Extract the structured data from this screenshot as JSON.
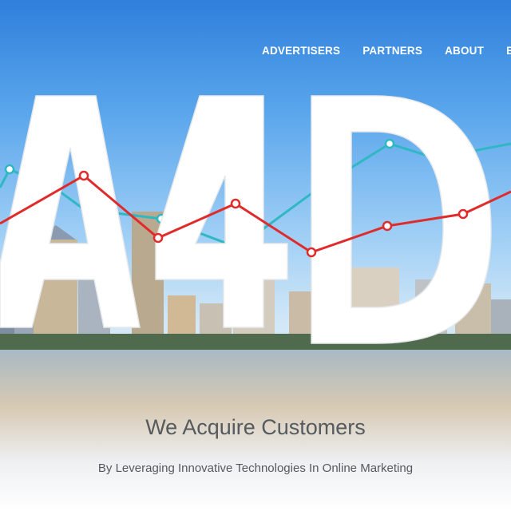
{
  "nav": {
    "items": [
      "ADVERTISERS",
      "PARTNERS",
      "ABOUT",
      "B"
    ]
  },
  "hero": {
    "logo_text": "A4D",
    "tagline": "We Acquire Customers",
    "subtagline": "By Leveraging Innovative Technologies In Online Marketing"
  },
  "colors": {
    "line_teal": "#2fb8c4",
    "line_red": "#e02b2b",
    "text_gray": "#555a5e"
  }
}
